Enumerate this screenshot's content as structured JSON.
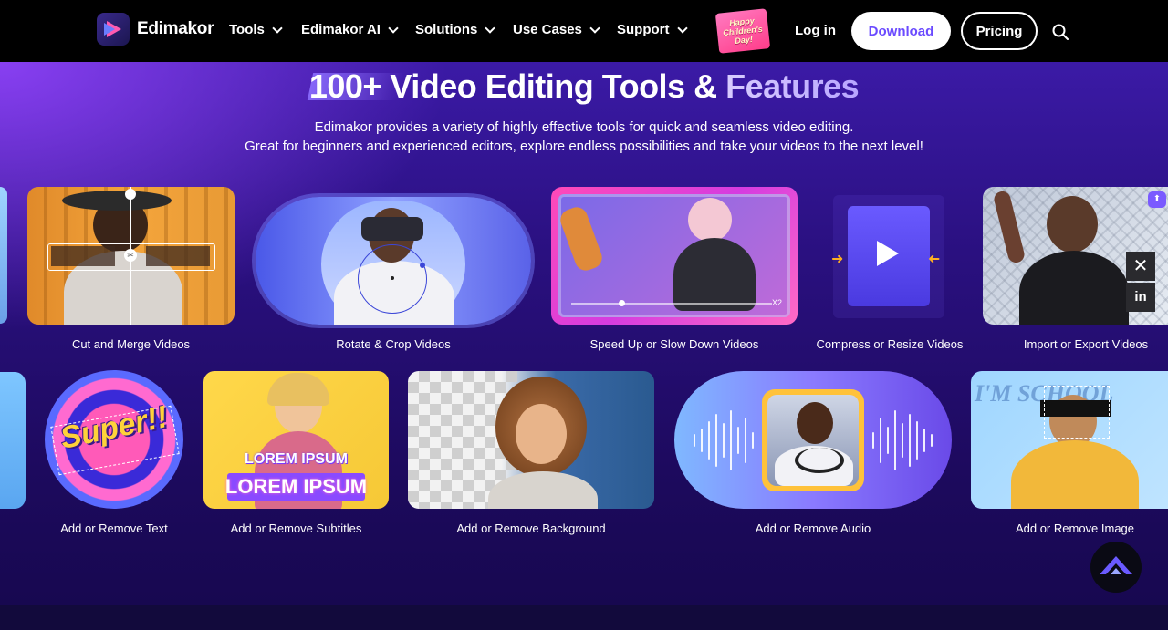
{
  "brand": {
    "name": "Edimakor"
  },
  "nav": {
    "items": [
      {
        "label": "Tools"
      },
      {
        "label": "Edimakor AI"
      },
      {
        "label": "Solutions"
      },
      {
        "label": "Use Cases"
      },
      {
        "label": "Support"
      }
    ],
    "promo": [
      "Happy",
      "Children's",
      "Day!"
    ],
    "login": "Log in",
    "download": "Download",
    "pricing": "Pricing"
  },
  "hero": {
    "headline_main": "100+ Video Editing Tools & ",
    "headline_accent": "Features",
    "subtitle_1": "Edimakor provides a variety of highly effective tools for quick and seamless video editing.",
    "subtitle_2": "Great for beginners and experienced editors, explore endless possibilities and take your videos to the next level!"
  },
  "row1": [
    {
      "label": "Cut and Merge Videos"
    },
    {
      "label": "Rotate & Crop Videos"
    },
    {
      "label": "Speed Up or Slow Down Videos",
      "speed": "X2"
    },
    {
      "label": "Compress or Resize Videos"
    },
    {
      "label": "Import or Export Videos"
    }
  ],
  "row2": [
    {
      "label": "Add or Remove Text",
      "sticker": "Super!!"
    },
    {
      "label": "Add or Remove Subtitles",
      "text_1": "LOREM IPSUM",
      "text_2": "LOREM IPSUM"
    },
    {
      "label": "Add or Remove Background"
    },
    {
      "label": "Add or Remove Audio"
    },
    {
      "label": "Add or Remove Image",
      "bg_text": "I'M SCHOOL"
    }
  ],
  "colors": {
    "accent": "#6b4bff",
    "nav_bg": "#000000",
    "hero_bg": "#2a1080"
  }
}
